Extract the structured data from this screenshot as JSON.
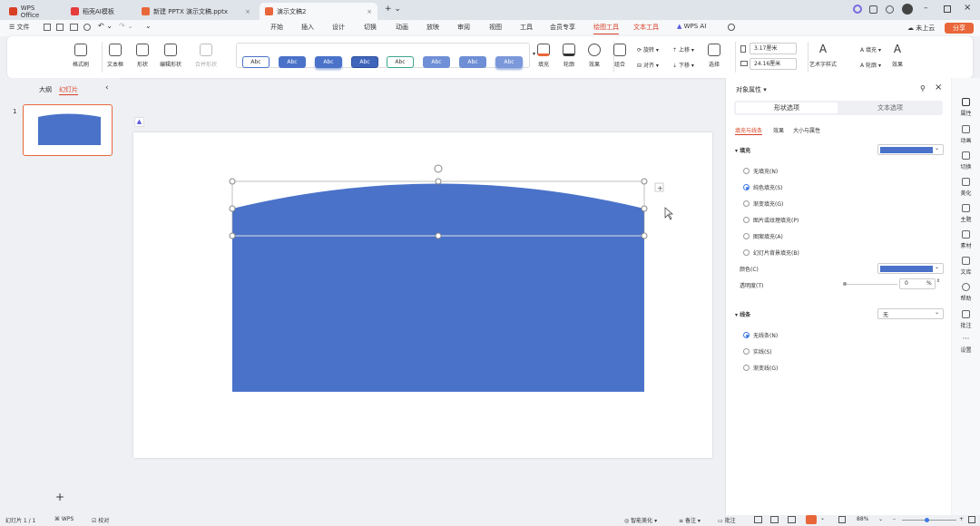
{
  "title_bar": {
    "tabs": [
      {
        "label": "WPS Office",
        "icon": "wps-logo-icon",
        "color": "#d93f23"
      },
      {
        "label": "稻壳AI模板",
        "icon": "docer-icon",
        "color": "#e53b3b"
      },
      {
        "label": "新建 PPTX 演示文稿.pptx",
        "icon": "ppt-file-icon",
        "color": "#e8663a"
      },
      {
        "label": "演示文稿2",
        "icon": "ppt-file-icon",
        "color": "#e8663a"
      }
    ],
    "new_tab": "+ ⌄"
  },
  "menu": {
    "file": "文件",
    "tabs": [
      "开始",
      "插入",
      "设计",
      "切换",
      "动画",
      "放映",
      "审阅",
      "视图",
      "工具",
      "会员专享",
      "绘图工具",
      "文本工具",
      "WPS AI"
    ],
    "active": "绘图工具",
    "cloud": "未上云",
    "share": "分享"
  },
  "ribbon": {
    "format_painter": "格式刷",
    "text_box": "文本框",
    "shape": "形状",
    "edit_shape": "编辑形状",
    "merge_shape": "合并形状",
    "style_presets": [
      "Abc",
      "Abc",
      "Abc",
      "Abc",
      "Abc",
      "Abc",
      "Abc",
      "Abc"
    ],
    "fill": "填充",
    "outline": "轮廓",
    "effect": "效果",
    "group": "组合",
    "rotate": "旋转",
    "align": "对齐",
    "bring_up": "上移",
    "send_down": "下移",
    "select": "选择",
    "height": "3.17厘米",
    "width": "24.16厘米",
    "art_text": "艺术字样式",
    "text_fill": "填充",
    "text_outline": "轮廓",
    "text_effect": "效果"
  },
  "left_panel": {
    "tab_outline": "大纲",
    "tab_slides": "幻灯片",
    "slide_number": "1",
    "add": "+"
  },
  "right_panel": {
    "title": "对象属性",
    "tab_shape": "形状选项",
    "tab_text": "文本选项",
    "subtabs": [
      "填充与线条",
      "效果",
      "大小与属性"
    ],
    "fill_header": "填充",
    "fill_color": "#4a72c9",
    "fill_options": [
      "无填充(N)",
      "纯色填充(S)",
      "渐变填充(G)",
      "图片或纹理填充(P)",
      "图案填充(A)",
      "幻灯片背景填充(B)"
    ],
    "fill_selected": 1,
    "color_label": "颜色(C)",
    "transparency_label": "透明度(T)",
    "transparency_value": "0",
    "transparency_unit": "%",
    "line_header": "线条",
    "line_value": "无",
    "line_options": [
      "无线条(N)",
      "实线(S)",
      "渐变线(G)"
    ],
    "line_selected": 0
  },
  "sidebar": [
    "属性",
    "动画",
    "切换",
    "美化",
    "主题",
    "素材",
    "文库",
    "帮助",
    "批注",
    "设置"
  ],
  "status": {
    "slide_info": "幻灯片 1 / 1",
    "theme": "WPS",
    "proof": "校对",
    "beautify": "智能美化",
    "notes": "备注",
    "comments": "批注",
    "zoom": "88%"
  },
  "colors": {
    "accent": "#d93f23",
    "shape": "#4a72c9",
    "selected_blue": "#3c7ae6"
  }
}
